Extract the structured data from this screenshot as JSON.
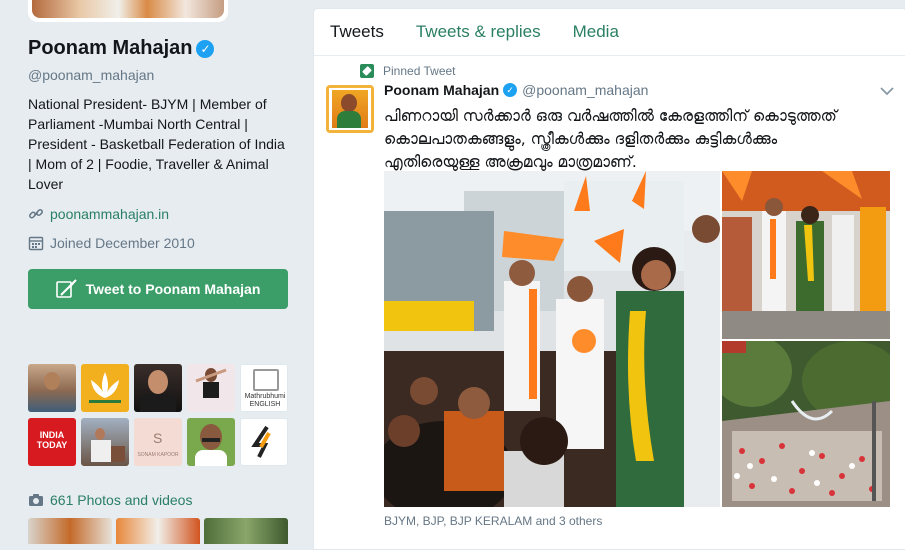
{
  "profile": {
    "name": "Poonam Mahajan",
    "handle": "@poonam_mahajan",
    "bio": "National President- BJYM | Member of Parliament -Mumbai North Central | President - Basketball Federation of India | Mom of 2 | Foodie, Traveller & Animal Lover",
    "website": "poonammahajan.in",
    "joined": "Joined December 2010",
    "tweet_to_label": "Tweet to Poonam Mahajan",
    "photos_videos": "661 Photos and videos",
    "follower_tiles": [
      {
        "label": "",
        "color": "#c8a78a"
      },
      {
        "label": "",
        "color": "#f2b01e"
      },
      {
        "label": "",
        "color": "#3a2e2a"
      },
      {
        "label": "",
        "color": "#f1e6e9"
      },
      {
        "label": "Mathrubhumi ENGLISH",
        "color": "#ffffff"
      },
      {
        "label": "INDIA TODAY",
        "color": "#d71920"
      },
      {
        "label": "",
        "color": "#a2b1c2"
      },
      {
        "label": "SONAM KAPOOR",
        "color": "#f4dcd4"
      },
      {
        "label": "",
        "color": "#7aa84d"
      },
      {
        "label": "",
        "color": "#ffffff"
      }
    ]
  },
  "timeline": {
    "tabs": [
      {
        "label": "Tweets",
        "active": true
      },
      {
        "label": "Tweets & replies",
        "active": false
      },
      {
        "label": "Media",
        "active": false
      }
    ],
    "pinned_label": "Pinned Tweet",
    "tweet": {
      "name": "Poonam Mahajan",
      "handle": "@poonam_mahajan",
      "text_lines": [
        "പിണറായി സർക്കാർ ഒരു വർഷത്തിൽ കേരളത്തിന് കൊടുത്തത്",
        "കൊലപാതകങ്ങളും, സ്ത്രീകൾക്കും ദളിതർക്കും കുട്ടികൾക്കും",
        "എതിരെയുള്ള അക്രമവും മാത്രമാണ്."
      ],
      "tagged": "BJYM, BJP, BJP KERALAM and 3 others"
    }
  },
  "colors": {
    "accent": "#2a7f64",
    "button": "#3b9e68",
    "verified": "#1da1f2"
  }
}
